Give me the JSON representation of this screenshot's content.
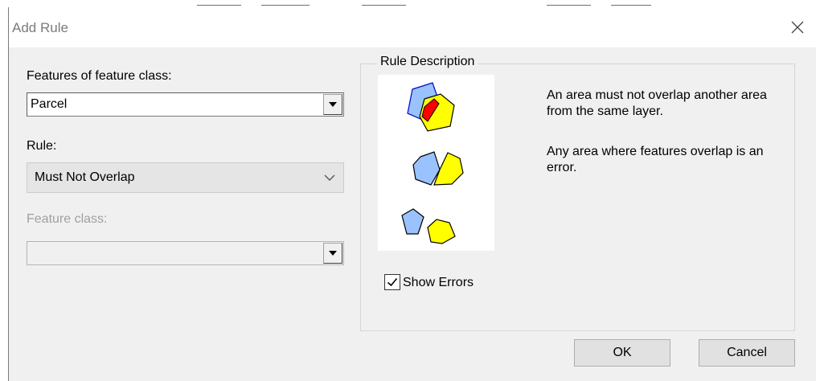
{
  "dialog": {
    "title": "Add Rule"
  },
  "form": {
    "features_label": "Features of feature class:",
    "features_value": "Parcel",
    "rule_label": "Rule:",
    "rule_value": "Must Not Overlap",
    "feature_class_label": "Feature class:",
    "feature_class_value": ""
  },
  "rule_description": {
    "legend": "Rule Description",
    "paragraph1": "An area must not overlap another area from the same layer.",
    "paragraph2": "Any area where features overlap is an error.",
    "colors": {
      "polygon_a": "#99c2ff",
      "polygon_b": "#ffff00",
      "error": "#ff0000",
      "outline": "#0000cc"
    }
  },
  "show_errors": {
    "label": "Show Errors",
    "checked": true
  },
  "buttons": {
    "ok": "OK",
    "cancel": "Cancel"
  }
}
